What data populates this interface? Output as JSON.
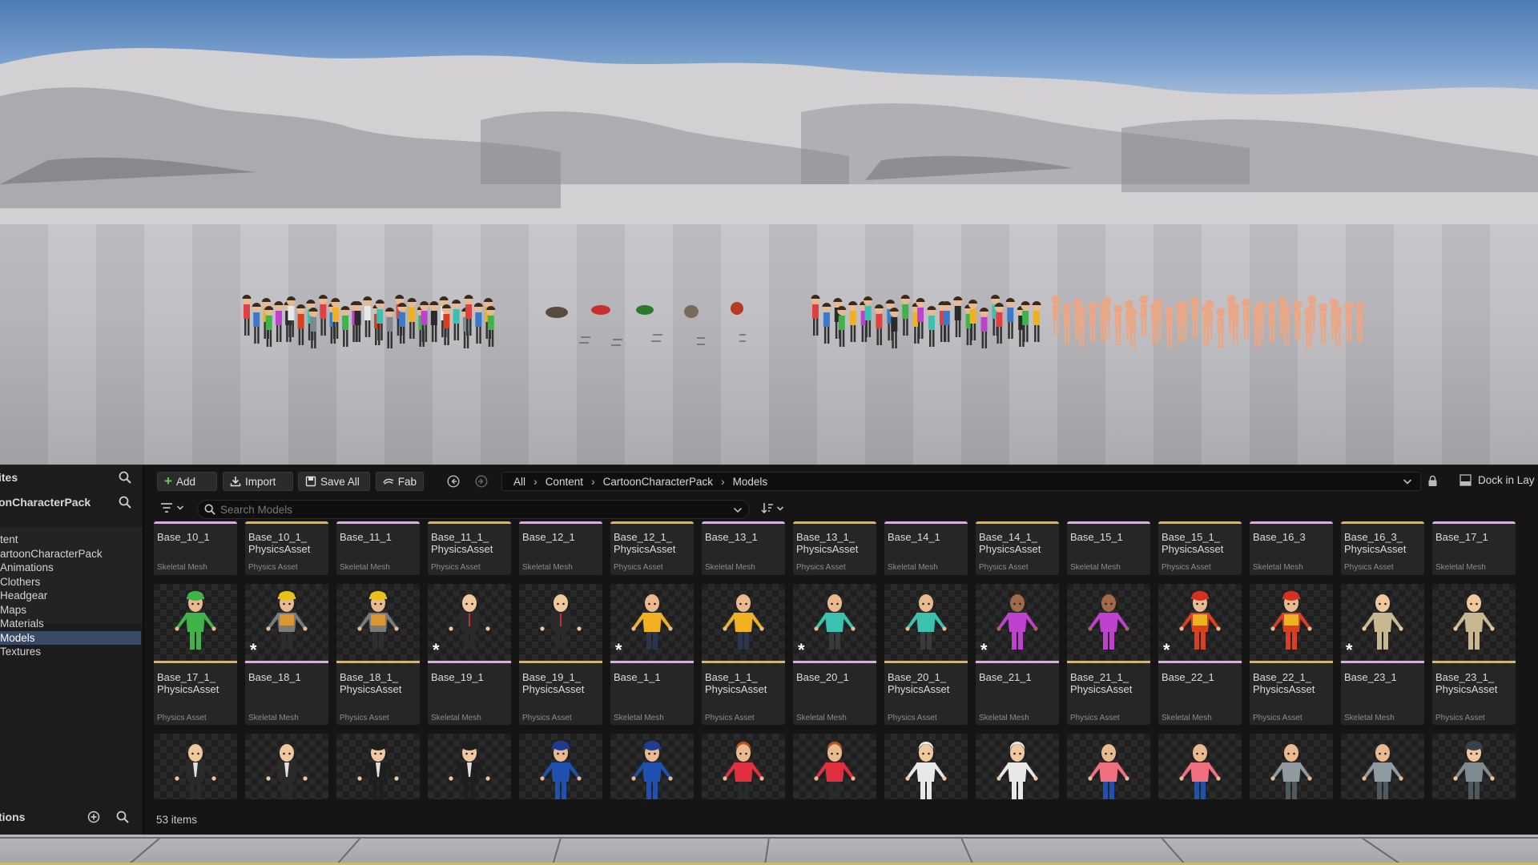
{
  "viewport": {
    "sky_top_color": "#4c7bb4",
    "floor_color": "#bdbdc2"
  },
  "sidebar": {
    "favorites_label": "ites",
    "collection_label": "onCharacterPack",
    "tree": [
      {
        "label": "tent",
        "selected": false
      },
      {
        "label": "artoonCharacterPack",
        "selected": false
      },
      {
        "label": "Animations",
        "selected": false
      },
      {
        "label": "Clothers",
        "selected": false
      },
      {
        "label": "Headgear",
        "selected": false
      },
      {
        "label": "Maps",
        "selected": false
      },
      {
        "label": "Materials",
        "selected": false
      },
      {
        "label": "Models",
        "selected": true
      },
      {
        "label": "Textures",
        "selected": false
      }
    ],
    "collections_label": "tions"
  },
  "toolbar": {
    "add_label": "Add",
    "import_label": "Import",
    "save_all_label": "Save All",
    "fab_label": "Fab",
    "dock_label": "Dock in Lay"
  },
  "breadcrumb": [
    "All",
    "Content",
    "CartoonCharacterPack",
    "Models"
  ],
  "search": {
    "placeholder": "Search Models"
  },
  "asset_rows": [
    [
      {
        "name": "Base_10_1",
        "type": "Skeletal Mesh",
        "bar": "pink"
      },
      {
        "name": "Base_10_1_ PhysicsAsset",
        "type": "Physics Asset",
        "bar": "gold"
      },
      {
        "name": "Base_11_1",
        "type": "Skeletal Mesh",
        "bar": "pink"
      },
      {
        "name": "Base_11_1_ PhysicsAsset",
        "type": "Physics Asset",
        "bar": "gold"
      },
      {
        "name": "Base_12_1",
        "type": "Skeletal Mesh",
        "bar": "pink"
      },
      {
        "name": "Base_12_1_ PhysicsAsset",
        "type": "Physics Asset",
        "bar": "gold"
      },
      {
        "name": "Base_13_1",
        "type": "Skeletal Mesh",
        "bar": "pink"
      },
      {
        "name": "Base_13_1_ PhysicsAsset",
        "type": "Physics Asset",
        "bar": "gold"
      },
      {
        "name": "Base_14_1",
        "type": "Skeletal Mesh",
        "bar": "pink"
      },
      {
        "name": "Base_14_1_ PhysicsAsset",
        "type": "Physics Asset",
        "bar": "gold"
      },
      {
        "name": "Base_15_1",
        "type": "Skeletal Mesh",
        "bar": "pink"
      },
      {
        "name": "Base_15_1_ PhysicsAsset",
        "type": "Physics Asset",
        "bar": "gold"
      },
      {
        "name": "Base_16_3",
        "type": "Skeletal Mesh",
        "bar": "pink"
      },
      {
        "name": "Base_16_3_ PhysicsAsset",
        "type": "Physics Asset",
        "bar": "gold"
      },
      {
        "name": "Base_17_1",
        "type": "Skeletal Mesh",
        "bar": "pink"
      }
    ],
    [
      {
        "name": "Base_17_1_ PhysicsAsset",
        "type": "Physics Asset",
        "bar": "gold",
        "star": false,
        "shirt": "#3fb34a",
        "pants": "#3fb34a",
        "hat": "#3fb34a",
        "skin": "#e9b98f"
      },
      {
        "name": "Base_18_1",
        "type": "Skeletal Mesh",
        "bar": "pink",
        "star": true,
        "shirt": "#7a7a7a",
        "pants": "#2d2d2d",
        "hat": "#e8c21a",
        "skin": "#e9b98f",
        "vest": "#e89a2a"
      },
      {
        "name": "Base_18_1_ PhysicsAsset",
        "type": "Physics Asset",
        "bar": "gold",
        "star": false,
        "shirt": "#7a7a7a",
        "pants": "#2d2d2d",
        "hat": "#e8c21a",
        "skin": "#e9b98f",
        "vest": "#e89a2a"
      },
      {
        "name": "Base_19_1",
        "type": "Skeletal Mesh",
        "bar": "pink",
        "star": true,
        "shirt": "#2a2a2a",
        "pants": "#2a2a2a",
        "hat": "",
        "skin": "#f0c8a0",
        "tie": "#c83030"
      },
      {
        "name": "Base_19_1_ PhysicsAsset",
        "type": "Physics Asset",
        "bar": "gold",
        "star": false,
        "shirt": "#2a2a2a",
        "pants": "#2a2a2a",
        "hat": "",
        "skin": "#f0c8a0",
        "tie": "#c83030"
      },
      {
        "name": "Base_1_1",
        "type": "Skeletal Mesh",
        "bar": "pink",
        "star": true,
        "shirt": "#f0b020",
        "pants": "#2a3550",
        "hat": "",
        "skin": "#e9b98f"
      },
      {
        "name": "Base_1_1_ PhysicsAsset",
        "type": "Physics Asset",
        "bar": "gold",
        "star": false,
        "shirt": "#f0b020",
        "pants": "#2a3550",
        "hat": "",
        "skin": "#e9b98f"
      },
      {
        "name": "Base_20_1",
        "type": "Skeletal Mesh",
        "bar": "pink",
        "star": true,
        "shirt": "#3cc0b0",
        "pants": "#3a3a3a",
        "hat": "",
        "skin": "#e9b98f"
      },
      {
        "name": "Base_20_1_ PhysicsAsset",
        "type": "Physics Asset",
        "bar": "gold",
        "star": false,
        "shirt": "#3cc0b0",
        "pants": "#3a3a3a",
        "hat": "",
        "skin": "#e9b98f"
      },
      {
        "name": "Base_21_1",
        "type": "Skeletal Mesh",
        "bar": "pink",
        "star": true,
        "shirt": "#c040d0",
        "pants": "#c040d0",
        "hat": "",
        "skin": "#a06a48"
      },
      {
        "name": "Base_21_1_ PhysicsAsset",
        "type": "Physics Asset",
        "bar": "gold",
        "star": false,
        "shirt": "#c040d0",
        "pants": "#c040d0",
        "hat": "",
        "skin": "#a06a48"
      },
      {
        "name": "Base_22_1",
        "type": "Skeletal Mesh",
        "bar": "pink",
        "star": true,
        "shirt": "#d84020",
        "pants": "#d84020",
        "hat": "#d83020",
        "skin": "#e9b98f",
        "vest": "#f0c020"
      },
      {
        "name": "Base_22_1_ PhysicsAsset",
        "type": "Physics Asset",
        "bar": "gold",
        "star": false,
        "shirt": "#d84020",
        "pants": "#d84020",
        "hat": "#d83020",
        "skin": "#e9b98f",
        "vest": "#f0c020"
      },
      {
        "name": "Base_23_1",
        "type": "Skeletal Mesh",
        "bar": "pink",
        "star": true,
        "shirt": "#c8b890",
        "pants": "#c8b890",
        "hat": "",
        "skin": "#f0c8a0"
      },
      {
        "name": "Base_23_1_ PhysicsAsset",
        "type": "Physics Asset",
        "bar": "gold",
        "star": false,
        "shirt": "#c8b890",
        "pants": "#c8b890",
        "hat": "",
        "skin": "#f0c8a0"
      }
    ],
    [
      {
        "shirt": "#e0e0e0",
        "pants": "#2a2a2a",
        "skin": "#f0c8a0",
        "jacket": "#2a2a2a"
      },
      {
        "shirt": "#e0e0e0",
        "pants": "#2a2a2a",
        "skin": "#f0c8a0",
        "jacket": "#2a2a2a"
      },
      {
        "shirt": "#e0e0e0",
        "pants": "#1e1e1e",
        "skin": "#f0c8a0",
        "jacket": "#1e1e1e",
        "hat": "#1e1e1e"
      },
      {
        "shirt": "#e0e0e0",
        "pants": "#1e1e1e",
        "skin": "#f0c8a0",
        "jacket": "#1e1e1e",
        "hat": "#1e1e1e"
      },
      {
        "shirt": "#2050b0",
        "pants": "#2050b0",
        "skin": "#e9b98f",
        "hat": "#1e3c90"
      },
      {
        "shirt": "#2050b0",
        "pants": "#2050b0",
        "skin": "#e9b98f",
        "hat": "#1e3c90"
      },
      {
        "shirt": "#e03040",
        "pants": "#2a2a2a",
        "skin": "#e9b98f",
        "hair": "#c05020"
      },
      {
        "shirt": "#e03040",
        "pants": "#2a2a2a",
        "skin": "#e9b98f",
        "hair": "#c05020"
      },
      {
        "shirt": "#e8e8e8",
        "pants": "#e8e8e8",
        "skin": "#f0c8a0",
        "hair": "#e8e8e8"
      },
      {
        "shirt": "#e8e8e8",
        "pants": "#e8e8e8",
        "skin": "#f0c8a0",
        "hair": "#e8e8e8"
      },
      {
        "shirt": "#f07080",
        "pants": "#2050b0",
        "skin": "#e9b98f"
      },
      {
        "shirt": "#f07080",
        "pants": "#2050b0",
        "skin": "#e9b98f"
      },
      {
        "shirt": "#909aa0",
        "pants": "#505860",
        "skin": "#e9b98f"
      },
      {
        "shirt": "#909aa0",
        "pants": "#505860",
        "skin": "#e9b98f"
      },
      {
        "shirt": "#808890",
        "pants": "#505860",
        "skin": "#f0c8a0",
        "hat": "#3a4048"
      }
    ]
  ],
  "status": {
    "item_count": "53 items"
  },
  "colors": {
    "pink_bar": "#e7a3ee",
    "gold_bar": "#e8b34a",
    "selection": "#3a4a66"
  }
}
